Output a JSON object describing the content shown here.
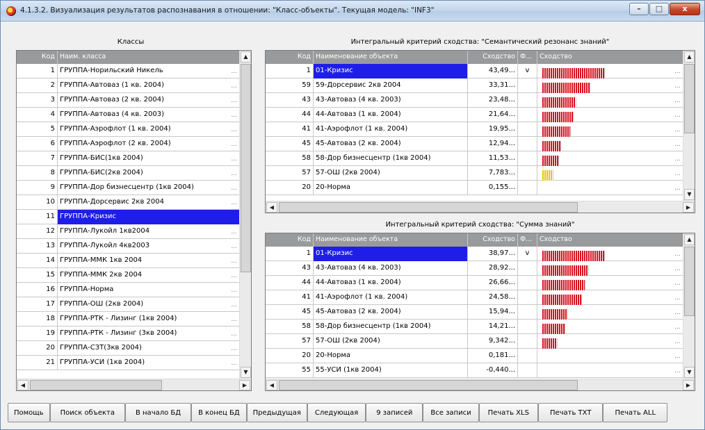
{
  "window": {
    "title": "4.1.3.2. Визуализация результатов распознавания в отношении: \"Класс-объекты\". Текущая модель: \"INF3\"",
    "min_glyph": "–",
    "max_glyph": "□",
    "close_glyph": "x"
  },
  "classes": {
    "title": "Классы",
    "headers": {
      "code": "Код",
      "name": "Наим. класса"
    },
    "rows": [
      {
        "code": "1",
        "name": "ГРУППА-Норильский Никель"
      },
      {
        "code": "2",
        "name": "ГРУППА-Автоваз (1 кв. 2004)"
      },
      {
        "code": "3",
        "name": "ГРУППА-Автоваз (2 кв. 2004)"
      },
      {
        "code": "4",
        "name": "ГРУППА-Автоваз (4 кв. 2003)"
      },
      {
        "code": "5",
        "name": "ГРУППА-Аэрофлот (1 кв. 2004)"
      },
      {
        "code": "6",
        "name": "ГРУППА-Аэрофлот (2 кв. 2004)"
      },
      {
        "code": "7",
        "name": "ГРУППА-БИС(1кв 2004)"
      },
      {
        "code": "8",
        "name": "ГРУППА-БИС(2кв 2004)"
      },
      {
        "code": "9",
        "name": "ГРУППА-Дор бизнесцентр (1кв 2004)"
      },
      {
        "code": "10",
        "name": "ГРУППА-Дорсервис 2кв 2004"
      },
      {
        "code": "11",
        "name": "ГРУППА-Кризис",
        "selected": true
      },
      {
        "code": "12",
        "name": "ГРУППА-Лукойл 1кв2004"
      },
      {
        "code": "13",
        "name": "ГРУППА-Лукойл 4кв2003"
      },
      {
        "code": "14",
        "name": "ГРУППА-ММК 1кв 2004"
      },
      {
        "code": "15",
        "name": "ГРУППА-ММК 2кв 2004"
      },
      {
        "code": "16",
        "name": "ГРУППА-Норма"
      },
      {
        "code": "17",
        "name": "ГРУППА-ОШ (2кв 2004)"
      },
      {
        "code": "18",
        "name": "ГРУППА-РТК - Лизинг (1кв 2004)"
      },
      {
        "code": "19",
        "name": "ГРУППА-РТК - Лизинг (3кв 2004)"
      },
      {
        "code": "20",
        "name": "ГРУППА-СЗТ(3кв 2004)"
      },
      {
        "code": "21",
        "name": "ГРУППА-УСИ (1кв 2004)"
      }
    ]
  },
  "semantic": {
    "title": "Интегральный критерий сходства: \"Семантический резонанс знаний\"",
    "headers": {
      "code": "Код",
      "name": "Наименование объекта",
      "sim": "Сходство",
      "f": "Ф...",
      "bar": "Сходство"
    },
    "rows": [
      {
        "code": "1",
        "name": "01-Кризис",
        "sim": "43,49...",
        "f": "v",
        "level": 43.49,
        "selected": true
      },
      {
        "code": "59",
        "name": "59-Дорсервис 2кв 2004",
        "sim": "33,31...",
        "f": "",
        "level": 33.31
      },
      {
        "code": "43",
        "name": "43-Автоваз (4 кв. 2003)",
        "sim": "23,48...",
        "f": "",
        "level": 23.48
      },
      {
        "code": "44",
        "name": "44-Автоваз (1 кв. 2004)",
        "sim": "21,64...",
        "f": "",
        "level": 21.64
      },
      {
        "code": "41",
        "name": "41-Аэрофлот (1 кв. 2004)",
        "sim": "19,95...",
        "f": "",
        "level": 19.95
      },
      {
        "code": "45",
        "name": "45-Автоваз (2 кв. 2004)",
        "sim": "12,94...",
        "f": "",
        "level": 12.94
      },
      {
        "code": "58",
        "name": "58-Дор бизнесцентр (1кв 2004)",
        "sim": "11,53...",
        "f": "",
        "level": 11.53
      },
      {
        "code": "57",
        "name": "57-ОШ (2кв 2004)",
        "sim": "7,783...",
        "f": "",
        "level": 7.783,
        "color": "yellow"
      },
      {
        "code": "20",
        "name": "20-Норма",
        "sim": "0,155...",
        "f": "",
        "level": 0.155
      }
    ]
  },
  "sum": {
    "title": "Интегральный критерий сходства: \"Сумма знаний\"",
    "headers": {
      "code": "Код",
      "name": "Наименование объекта",
      "sim": "Сходство",
      "f": "Ф...",
      "bar": "Сходство"
    },
    "rows": [
      {
        "code": "1",
        "name": "01-Кризис",
        "sim": "38,97...",
        "f": "v",
        "level": 38.97,
        "selected": true
      },
      {
        "code": "43",
        "name": "43-Автоваз (4 кв. 2003)",
        "sim": "28,92...",
        "f": "",
        "level": 28.92
      },
      {
        "code": "44",
        "name": "44-Автоваз (1 кв. 2004)",
        "sim": "26,66...",
        "f": "",
        "level": 26.66
      },
      {
        "code": "41",
        "name": "41-Аэрофлот (1 кв. 2004)",
        "sim": "24,58...",
        "f": "",
        "level": 24.58
      },
      {
        "code": "45",
        "name": "45-Автоваз (2 кв. 2004)",
        "sim": "15,94...",
        "f": "",
        "level": 15.94
      },
      {
        "code": "58",
        "name": "58-Дор бизнесцентр (1кв 2004)",
        "sim": "14,21...",
        "f": "",
        "level": 14.21
      },
      {
        "code": "57",
        "name": "57-ОШ (2кв 2004)",
        "sim": "9,342...",
        "f": "",
        "level": 9.342
      },
      {
        "code": "20",
        "name": "20-Норма",
        "sim": "0,181...",
        "f": "",
        "level": 0.181
      },
      {
        "code": "55",
        "name": "55-УСИ (1кв 2004)",
        "sim": "-0,440...",
        "f": "",
        "level": -0.44
      }
    ]
  },
  "ellipsis": "...",
  "buttons": {
    "help": "Помощь",
    "find": "Поиск объекта",
    "to_start": "В начало БД",
    "to_end": "В конец БД",
    "prev": "Предыдущая",
    "next": "Следующая",
    "nine": "9 записей",
    "all": "Все записи",
    "print_xls": "Печать XLS",
    "print_txt": "Печать TXT",
    "print_all": "Печать ALL"
  }
}
